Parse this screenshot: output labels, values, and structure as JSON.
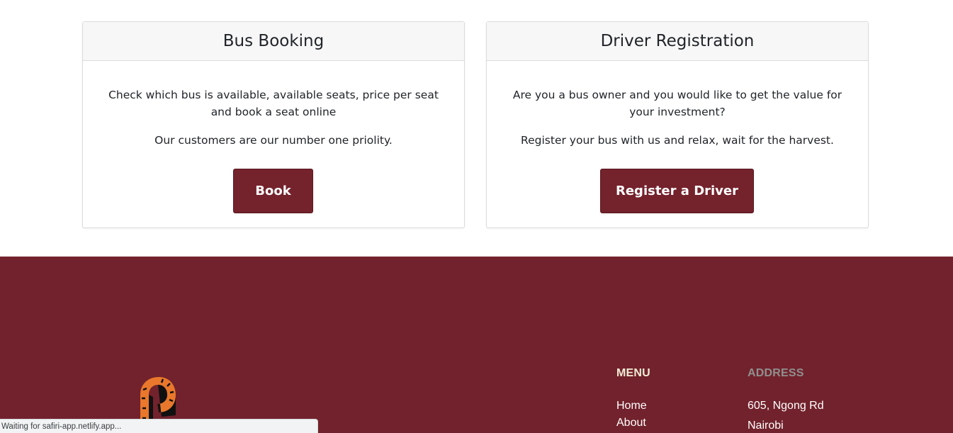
{
  "cards": {
    "booking": {
      "title": "Bus Booking",
      "text_1": "Check which bus is available, available seats, price per seat and book a seat online",
      "text_2": "Our customers are our number one priolity.",
      "button_label": "Book"
    },
    "registration": {
      "title": "Driver Registration",
      "text_1": "Are you a bus owner and you would like to get the value for your investment?",
      "text_2": "Register your bus with us and relax, wait for the harvest.",
      "button_label": "Register a Driver"
    }
  },
  "footer": {
    "menu": {
      "heading": "MENU",
      "items": [
        "Home",
        "About"
      ]
    },
    "address": {
      "heading": "ADDRESS",
      "lines": [
        "605, Ngong Rd",
        "Nairobi"
      ]
    },
    "logo_icon": "bus-wheel-logo-icon"
  },
  "status_bar": {
    "text": "Waiting for safiri-app.netlify.app..."
  },
  "colors": {
    "brand_maroon": "#72222c",
    "button_maroon": "#74222c",
    "logo_orange": "#e9782c",
    "menu_heading": "#f1ecd6",
    "address_heading": "#8f8f8f"
  }
}
